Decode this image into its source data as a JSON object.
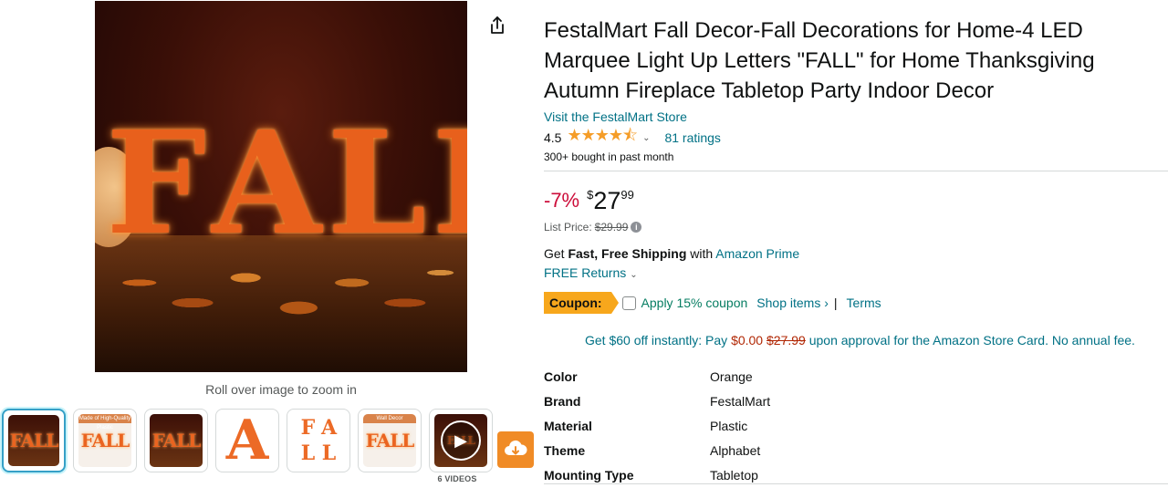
{
  "product": {
    "title": "FestalMart Fall Decor-Fall Decorations for Home-4 LED Marquee Light Up Letters \"FALL\" for Home Thanksgiving Autumn Fireplace Tabletop Party Indoor Decor",
    "store_link": "Visit the FestalMart Store",
    "rating": "4.5",
    "stars": "★★★★⯪",
    "ratings_count": "81 ratings",
    "bought": "300+ bought in past month"
  },
  "gallery": {
    "main_letters": [
      "F",
      "A",
      "L",
      "L"
    ],
    "zoom_hint": "Roll over image to zoom in",
    "thumbs": [
      {
        "label": "FALL"
      },
      {
        "label": "FALL",
        "banner": "Made of High-Quality Plastic"
      },
      {
        "label": "FALL"
      },
      {
        "label": "A"
      },
      {
        "letters": [
          "F",
          "A",
          "L",
          "L"
        ]
      },
      {
        "label": "FALL",
        "banner": "Wall Decor"
      },
      {
        "label": "FALL"
      }
    ],
    "videos_label": "6 VIDEOS"
  },
  "price": {
    "discount": "-7%",
    "currency": "$",
    "whole": "27",
    "fraction": "99",
    "list_label": "List Price:",
    "list_value": "$29.99"
  },
  "shipping": {
    "get": "Get",
    "fast": "Fast, Free Shipping",
    "with": "with",
    "prime": "Amazon Prime",
    "returns": "FREE Returns"
  },
  "coupon": {
    "badge": "Coupon:",
    "apply": "Apply 15% coupon",
    "shop_items": "Shop items ›",
    "separator": "|",
    "terms": "Terms"
  },
  "card_offer": {
    "prefix": "Get $60 off instantly: Pay",
    "pay": "$0.00",
    "original": "$27.99",
    "suffix": "upon approval for the Amazon Store Card. No annual fee."
  },
  "specs": [
    {
      "label": "Color",
      "value": "Orange"
    },
    {
      "label": "Brand",
      "value": "FestalMart"
    },
    {
      "label": "Material",
      "value": "Plastic"
    },
    {
      "label": "Theme",
      "value": "Alphabet"
    },
    {
      "label": "Mounting Type",
      "value": "Tabletop"
    }
  ],
  "colors": {
    "link": "#007185",
    "discount": "#cc0c39",
    "coupon": "#f7a71c",
    "star": "#f59d28",
    "download": "#f08b26"
  }
}
